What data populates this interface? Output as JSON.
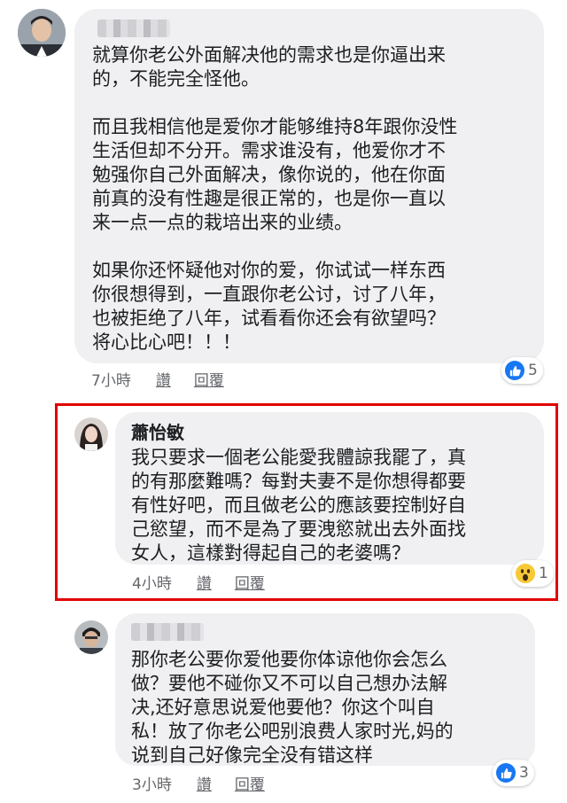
{
  "comments": [
    {
      "author": "",
      "text": "就算你老公外面解决他的需求也是你逼出来\n的，不能完全怪他。\n\n而且我相信他是爱你才能够维持8年跟你没性\n生活但却不分开。需求谁没有，他爱你才不\n勉强你自己外面解决，像你说的，他在你面\n前真的没有性趣是很正常的，也是你一直以\n来一点一点的栽培出来的业绩。\n\n如果你还怀疑他对你的爱，你试试一样东西\n你很想得到，一直跟你老公讨，讨了八年，\n也被拒绝了八年，试看看你还会有欲望吗？\n将心比心吧！！！",
      "time": "7小時",
      "like_label": "讚",
      "reply_label": "回覆",
      "reaction": {
        "type": "like-icon",
        "count": "5",
        "color": "#1877f2"
      }
    },
    {
      "author": "蕭怡敏",
      "text": "我只要求一個老公能愛我體諒我罷了，真\n的有那麼難嗎？每對夫妻不是你想得都要\n有性好吧，而且做老公的應該要控制好自\n己慾望，而不是為了要洩慾就出去外面找\n女人，這樣對得起自己的老婆嗎？",
      "time": "4小時",
      "like_label": "讚",
      "reply_label": "回覆",
      "reaction": {
        "type": "wow-icon",
        "count": "1",
        "color": "#f7c937"
      }
    },
    {
      "author": "",
      "text": "那你老公要你爱他要你体谅他你会怎么\n做？要他不碰你又不可以自己想办法解\n决,还好意思说爱他要他？你这个叫自\n私！放了你老公吧别浪费人家时光,妈的\n说到自己好像完全没有错这样",
      "time": "3小時",
      "like_label": "讚",
      "reply_label": "回覆",
      "reaction": {
        "type": "like-icon",
        "count": "3",
        "color": "#1877f2"
      }
    }
  ],
  "highlight_color": "#e00000"
}
